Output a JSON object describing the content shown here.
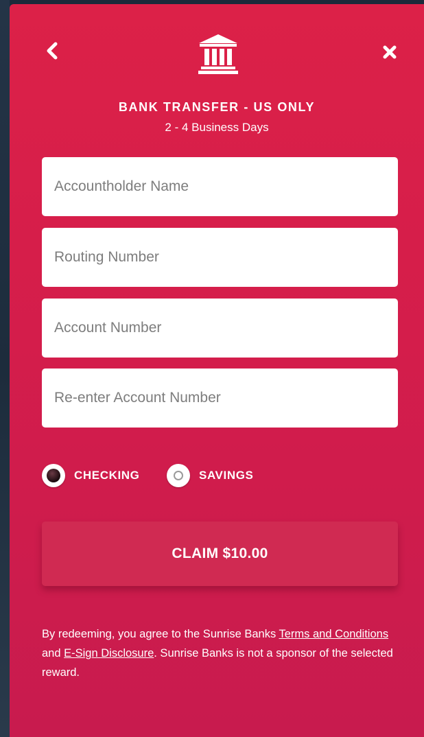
{
  "header": {
    "back_icon": "chevron-left-icon",
    "bank_icon": "bank-building-icon",
    "close_icon": "close-x-icon",
    "title": "BANK TRANSFER - US ONLY",
    "subtitle": "2 - 4 Business Days"
  },
  "form": {
    "accountholder_name": {
      "placeholder": "Accountholder Name",
      "value": ""
    },
    "routing_number": {
      "placeholder": "Routing Number",
      "value": ""
    },
    "account_number": {
      "placeholder": "Account Number",
      "value": ""
    },
    "reenter_account_number": {
      "placeholder": "Re-enter Account Number",
      "value": ""
    }
  },
  "account_type": {
    "selected": "checking",
    "options": [
      {
        "id": "checking",
        "label": "CHECKING"
      },
      {
        "id": "savings",
        "label": "SAVINGS"
      }
    ]
  },
  "claim_button": {
    "label": "CLAIM $10.00"
  },
  "disclaimer": {
    "text_1": "By redeeming, you agree to the Sunrise Banks ",
    "link_terms": "Terms and Conditions",
    "text_2": " and ",
    "link_esign": "E-Sign Disclosure",
    "text_3": ". Sunrise Banks is not a sponsor of the selected reward."
  },
  "colors": {
    "panel_top": "#dc2148",
    "panel_bottom": "#c81b4e",
    "button": "#d02a52",
    "text": "#ffffff"
  }
}
